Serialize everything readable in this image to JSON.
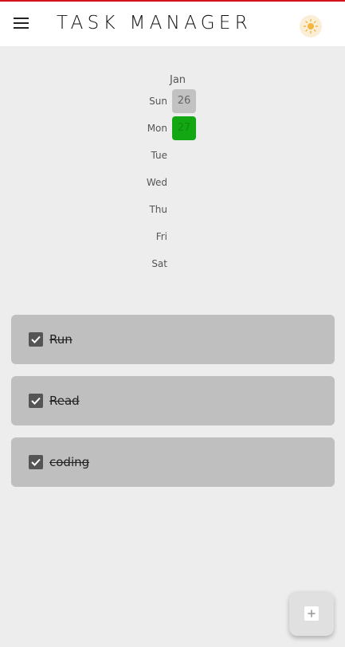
{
  "app": {
    "title": "TASK MANAGER"
  },
  "icons": {
    "menu": "menu-icon",
    "theme": "sun-icon",
    "add": "add-icon",
    "check": "checkbox-checked-icon"
  },
  "colors": {
    "accent_top": "#d4141c",
    "today": "#13a813",
    "past_day": "#c2c2c2",
    "task_card": "#bfbfbf"
  },
  "calendar": {
    "month": "Jan",
    "days": [
      {
        "label": "Sun",
        "date": "26"
      },
      {
        "label": "Mon",
        "date": "27"
      },
      {
        "label": "Tue",
        "date": ""
      },
      {
        "label": "Wed",
        "date": ""
      },
      {
        "label": "Thu",
        "date": ""
      },
      {
        "label": "Fri",
        "date": ""
      },
      {
        "label": "Sat",
        "date": ""
      }
    ]
  },
  "tasks": [
    {
      "label": "Run",
      "done": true
    },
    {
      "label": "Read",
      "done": true
    },
    {
      "label": "coding",
      "done": true
    }
  ]
}
